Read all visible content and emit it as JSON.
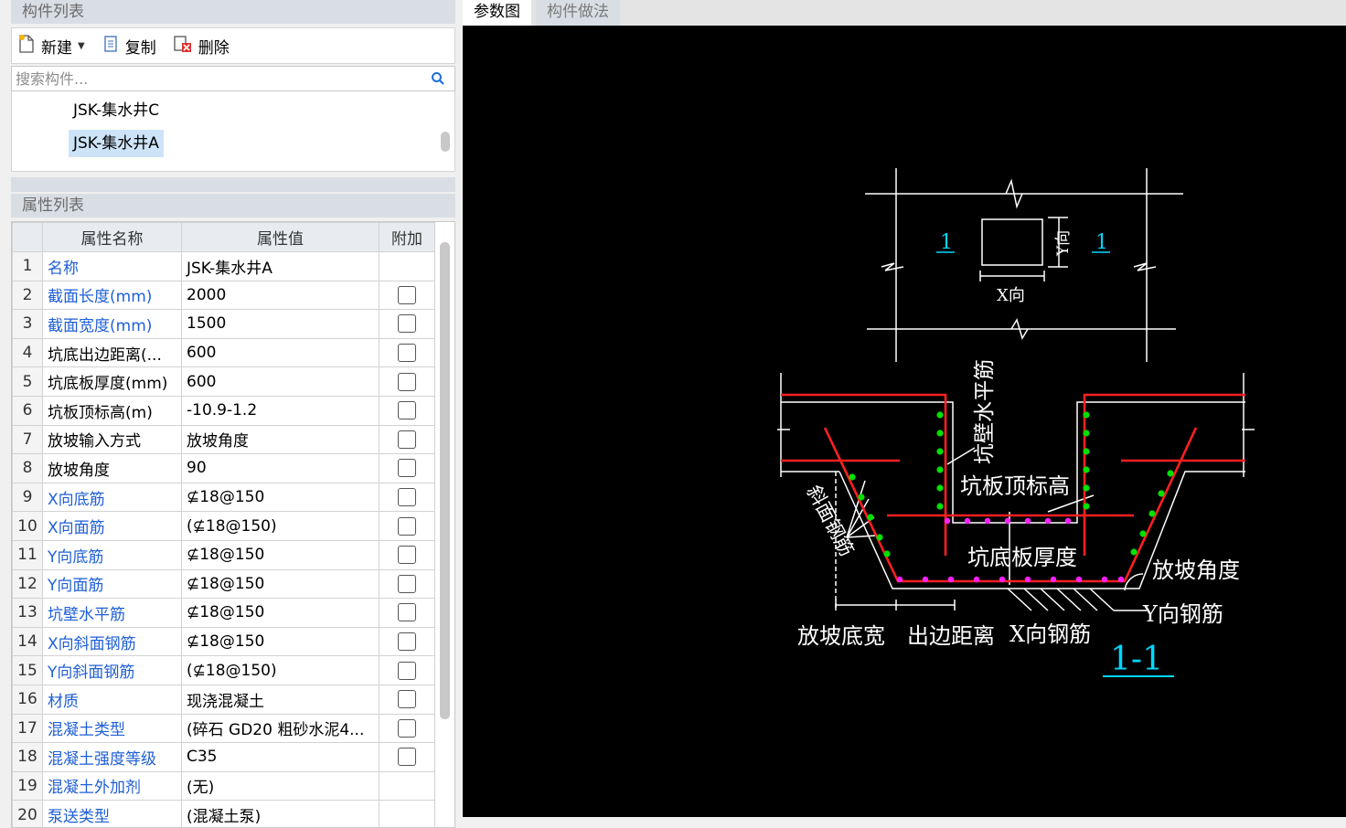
{
  "component_list": {
    "header": "构件列表",
    "toolbar": {
      "new_label": "新建",
      "copy_label": "复制",
      "delete_label": "删除"
    },
    "search_placeholder": "搜索构件...",
    "items": [
      {
        "label": "JSK-集水井C",
        "selected": false
      },
      {
        "label": "JSK-集水井A",
        "selected": true
      }
    ]
  },
  "property_list": {
    "header": "属性列表",
    "columns": [
      "属性名称",
      "属性值",
      "附加"
    ],
    "rows": [
      {
        "num": "1",
        "name": "名称",
        "value": "JSK-集水井A",
        "blue": true,
        "checkbox": false
      },
      {
        "num": "2",
        "name": "截面长度(mm)",
        "value": "2000",
        "blue": true,
        "checkbox": true
      },
      {
        "num": "3",
        "name": "截面宽度(mm)",
        "value": "1500",
        "blue": true,
        "checkbox": true
      },
      {
        "num": "4",
        "name": "坑底出边距离(...",
        "value": "600",
        "blue": false,
        "checkbox": true
      },
      {
        "num": "5",
        "name": "坑底板厚度(mm)",
        "value": "600",
        "blue": false,
        "checkbox": true
      },
      {
        "num": "6",
        "name": "坑板顶标高(m)",
        "value": "-10.9-1.2",
        "blue": false,
        "checkbox": true
      },
      {
        "num": "7",
        "name": "放坡输入方式",
        "value": "放坡角度",
        "blue": false,
        "checkbox": true
      },
      {
        "num": "8",
        "name": "放坡角度",
        "value": "90",
        "blue": false,
        "checkbox": true
      },
      {
        "num": "9",
        "name": "X向底筋",
        "value": "⊈18@150",
        "blue": true,
        "checkbox": true
      },
      {
        "num": "10",
        "name": "X向面筋",
        "value": "(⊈18@150)",
        "blue": true,
        "checkbox": true
      },
      {
        "num": "11",
        "name": "Y向底筋",
        "value": "⊈18@150",
        "blue": true,
        "checkbox": true
      },
      {
        "num": "12",
        "name": "Y向面筋",
        "value": "⊈18@150",
        "blue": true,
        "checkbox": true
      },
      {
        "num": "13",
        "name": "坑壁水平筋",
        "value": "⊈18@150",
        "blue": true,
        "checkbox": true
      },
      {
        "num": "14",
        "name": "X向斜面钢筋",
        "value": "⊈18@150",
        "blue": true,
        "checkbox": true
      },
      {
        "num": "15",
        "name": "Y向斜面钢筋",
        "value": "(⊈18@150)",
        "blue": true,
        "checkbox": true
      },
      {
        "num": "16",
        "name": "材质",
        "value": "现浇混凝土",
        "blue": true,
        "checkbox": true
      },
      {
        "num": "17",
        "name": "混凝土类型",
        "value": "(碎石 GD20 粗砂水泥4...",
        "blue": true,
        "checkbox": true
      },
      {
        "num": "18",
        "name": "混凝土强度等级",
        "value": "C35",
        "blue": true,
        "checkbox": true
      },
      {
        "num": "19",
        "name": "混凝土外加剂",
        "value": "(无)",
        "blue": true,
        "checkbox": false
      },
      {
        "num": "20",
        "name": "泵送类型",
        "value": "(混凝土泵)",
        "blue": true,
        "checkbox": false
      }
    ]
  },
  "tabs": {
    "param_diagram": "参数图",
    "component_method": "构件做法"
  },
  "drawing": {
    "section_mark_left": "1",
    "section_mark_right": "1",
    "x_dir": "X向",
    "y_dir": "Y向",
    "wall_horizontal_rebar": "坑壁水平筋",
    "slab_top_elevation": "坑板顶标高",
    "slope_rebar": "斜面钢筋",
    "bottom_slab_thickness": "坑底板厚度",
    "slope_angle": "放坡角度",
    "y_rebar": "Y向钢筋",
    "slope_bottom_width": "放坡底宽",
    "edge_distance": "出边距离",
    "x_rebar": "X向钢筋",
    "section_title": "1-1"
  },
  "colors": {
    "canvas_bg": "#000000",
    "line_white": "#ffffff",
    "rebar_red": "#ff0000",
    "dot_green": "#00e000",
    "dot_magenta": "#ff00ff",
    "cyan_text": "#00d8ff",
    "link_blue": "#1f5fd6"
  }
}
